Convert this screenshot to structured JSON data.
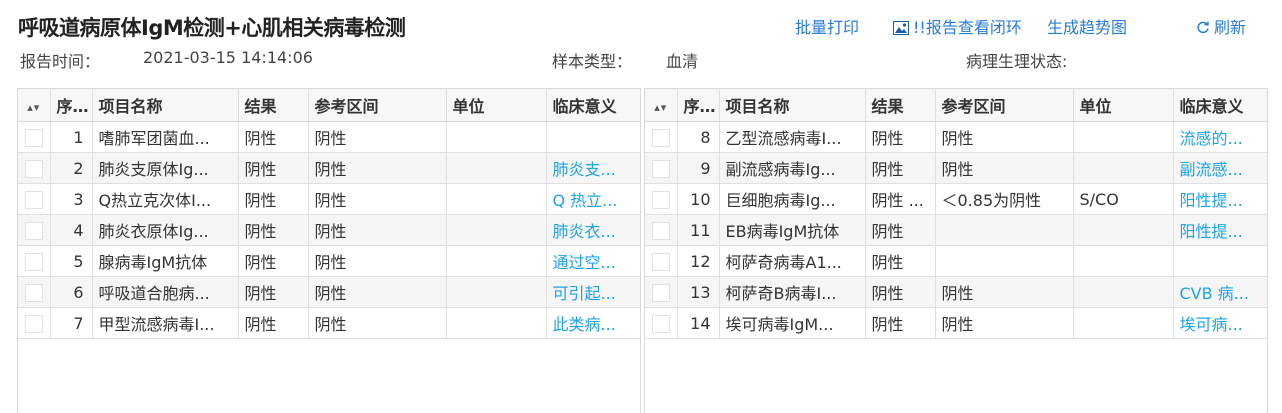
{
  "page": {
    "title": "呼吸道病原体IgM检测+心肌相关病毒检测"
  },
  "meta": {
    "report_time_label": "报告时间：",
    "report_time_value": "2021-03-15 14:14:06",
    "sample_type_label": "样本类型：",
    "sample_type_value": "血清",
    "physio_state_label": "病理生理状态:"
  },
  "toolbar": {
    "batch_print": "批量打印",
    "report_loop": "!!报告查看闭环",
    "trend": "生成趋势图",
    "refresh": "刷新"
  },
  "icons": {
    "sort": "sort-icon",
    "image": "image-icon",
    "refresh": "refresh-icon"
  },
  "colors": {
    "link": "#2a7bd4",
    "significance": "#1fa3e6"
  },
  "table": {
    "sort_header": "▴▾",
    "columns": {
      "seq": "序...",
      "name": "项目名称",
      "result": "结果",
      "ref": "参考区间",
      "unit": "单位",
      "sig": "临床意义"
    },
    "left_rows": [
      {
        "seq": "1",
        "name": "嗜肺军团菌血...",
        "result": "阴性",
        "ref": "阴性",
        "unit": "",
        "sig": ""
      },
      {
        "seq": "2",
        "name": "肺炎支原体Ig...",
        "result": "阴性",
        "ref": "阴性",
        "unit": "",
        "sig": "肺炎支..."
      },
      {
        "seq": "3",
        "name": "Q热立克次体I...",
        "result": "阴性",
        "ref": "阴性",
        "unit": "",
        "sig": "Q 热立..."
      },
      {
        "seq": "4",
        "name": "肺炎衣原体Ig...",
        "result": "阴性",
        "ref": "阴性",
        "unit": "",
        "sig": "肺炎衣..."
      },
      {
        "seq": "5",
        "name": "腺病毒IgM抗体",
        "result": "阴性",
        "ref": "阴性",
        "unit": "",
        "sig": "通过空..."
      },
      {
        "seq": "6",
        "name": "呼吸道合胞病...",
        "result": "阴性",
        "ref": "阴性",
        "unit": "",
        "sig": "可引起..."
      },
      {
        "seq": "7",
        "name": "甲型流感病毒I...",
        "result": "阴性",
        "ref": "阴性",
        "unit": "",
        "sig": "此类病..."
      }
    ],
    "right_rows": [
      {
        "seq": "8",
        "name": "乙型流感病毒I...",
        "result": "阴性",
        "ref": "阴性",
        "unit": "",
        "sig": "流感的..."
      },
      {
        "seq": "9",
        "name": "副流感病毒Ig...",
        "result": "阴性",
        "ref": "阴性",
        "unit": "",
        "sig": "副流感..."
      },
      {
        "seq": "10",
        "name": "巨细胞病毒Ig...",
        "result": "阴性 ...",
        "ref": "＜0.85为阴性",
        "unit": "S/CO",
        "sig": "阳性提..."
      },
      {
        "seq": "11",
        "name": "EB病毒IgM抗体",
        "result": "阴性",
        "ref": "",
        "unit": "",
        "sig": "阳性提..."
      },
      {
        "seq": "12",
        "name": "柯萨奇病毒A1...",
        "result": "阴性",
        "ref": "",
        "unit": "",
        "sig": ""
      },
      {
        "seq": "13",
        "name": "柯萨奇B病毒I...",
        "result": "阴性",
        "ref": "阴性",
        "unit": "",
        "sig": "CVB 病..."
      },
      {
        "seq": "14",
        "name": "埃可病毒IgM...",
        "result": "阴性",
        "ref": "阴性",
        "unit": "",
        "sig": "埃可病..."
      }
    ]
  }
}
